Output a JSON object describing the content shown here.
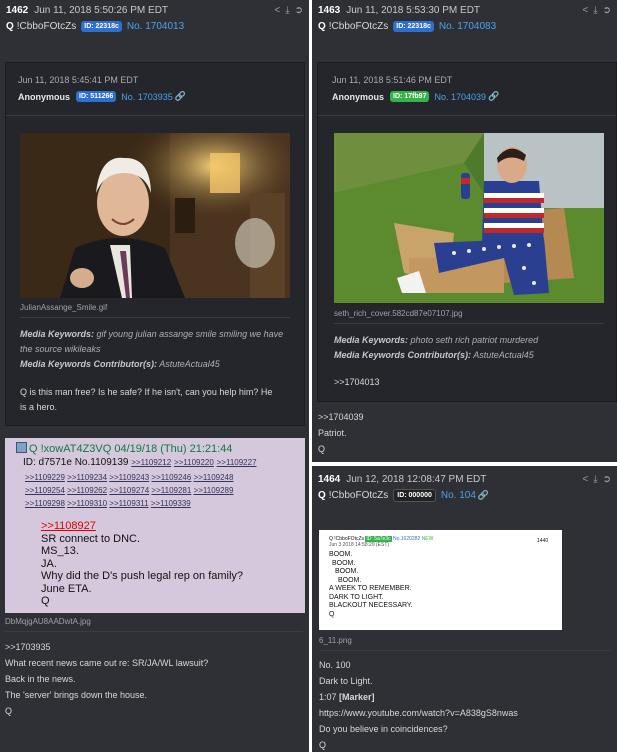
{
  "post1462": {
    "number": "1462",
    "timestamp": "Jun 11, 2018 5:50:26 PM EDT",
    "author": "Q",
    "tripcode": "!CbboFOtcZs",
    "id_badge": "ID: 22318c",
    "post_no": "No. 1704013",
    "quote": {
      "timestamp": "Jun 11, 2018 5:45:41 PM EDT",
      "author": "Anonymous",
      "id_badge": "ID: 511266",
      "post_no": "No. 1703935",
      "image_filename": "JulianAssange_Smile.gif",
      "keywords_label": "Media Keywords:",
      "keywords": "gif young julian assange smile smiling we have the source wikileaks",
      "contributor_label": "Media Keywords Contributor(s):",
      "contributor": "AstuteActual45",
      "text_line1": "Q is this man free? Is he safe? If he isn't, can you help him? He",
      "text_line2": "is a hero."
    },
    "image2_filename": "DbMqjgAU8AADwtA.jpg",
    "lines": [
      "&gt;&gt;1703935",
      "What recent news came out re: SR/JA/WL lawsuit?",
      "Back in the news.",
      "The 'server' brings down the house.",
      "Q"
    ]
  },
  "chan_screenshot": {
    "header": "Q !xowAT4Z3VQ  04/19/18 (Thu) 21:21:44",
    "id_line": "ID: d7571e No.1109139",
    "reply_links": [
      ">>1109212",
      ">>1109220",
      ">>1109227",
      ">>1109229",
      ">>1109234",
      ">>1109243",
      ">>1109246",
      ">>1109248",
      ">>1109254",
      ">>1109262",
      ">>1109274",
      ">>1109281",
      ">>1109289",
      ">>1109298",
      ">>1109310",
      ">>1109311",
      ">>1109339"
    ],
    "quote_link": ">>1108927",
    "body": [
      "SR connect to DNC.",
      "MS_13.",
      "JA.",
      "Why did the D's push legal rep on family?",
      "June ETA.",
      "Q"
    ]
  },
  "post1463": {
    "number": "1463",
    "timestamp": "Jun 11, 2018 5:53:30 PM EDT",
    "author": "Q",
    "tripcode": "!CbboFOtcZs",
    "id_badge": "ID: 22318c",
    "post_no": "No. 1704083",
    "quote": {
      "timestamp": "Jun 11, 2018 5:51:46 PM EDT",
      "author": "Anonymous",
      "id_badge": "ID: 17fb97",
      "post_no": "No. 1704039",
      "image_filename": "seth_rich_cover.582cd87e07107.jpg",
      "keywords_label": "Media Keywords:",
      "keywords": "photo seth rich patriot murdered",
      "contributor_label": "Media Keywords Contributor(s):",
      "contributor": "AstuteActual45",
      "text": ">>1704013"
    },
    "lines": [
      ">>1704039",
      "Patriot.",
      "Q"
    ]
  },
  "post1464": {
    "number": "1464",
    "timestamp": "Jun 12, 2018 12:08:47 PM EDT",
    "author": "Q",
    "tripcode": "!CbboFOtcZs",
    "id_badge": "ID: 000000",
    "post_no": "No. 104",
    "image_filename": "6_11.png",
    "mini": {
      "header": "Q !CbboFOtcZs",
      "id": "ID: 5a7e3c",
      "no": "No.1620282",
      "new": "NEW",
      "date": "Jun 3 2018 14:58:29 (EST)",
      "count": "1440",
      "body": [
        "BOOM.",
        "BOOM.",
        "BOOM.",
        "BOOM.",
        "A WEEK TO REMEMBER.",
        "DARK TO LIGHT.",
        "BLACKOUT NECESSARY.",
        "Q"
      ]
    },
    "lines": [
      "No. 100",
      "Dark to Light.",
      "1:07",
      "[Marker]",
      "https://www.youtube.com/watch?v=A838gS8nwas",
      "Do you believe in coincidences?",
      "Q"
    ]
  },
  "colors": {
    "panel": "#2e3036",
    "inner": "#24262b",
    "link": "#4aa3ea",
    "badge_blue": "#2f6fcf",
    "badge_green": "#35b34a",
    "chan_bg": "#d6c8dc"
  }
}
